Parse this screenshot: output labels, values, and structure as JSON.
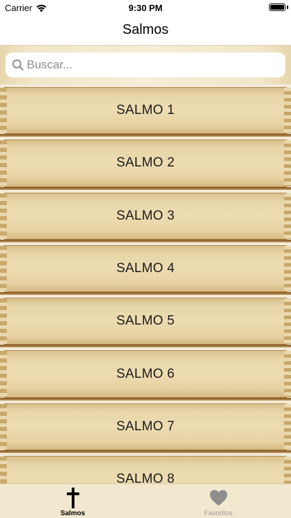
{
  "status_bar": {
    "carrier": "Carrier",
    "time": "9:30 PM"
  },
  "nav": {
    "title": "Salmos"
  },
  "search": {
    "placeholder": "Buscar..."
  },
  "psalms": [
    {
      "label": "SALMO 1"
    },
    {
      "label": "SALMO 2"
    },
    {
      "label": "SALMO 3"
    },
    {
      "label": "SALMO 4"
    },
    {
      "label": "SALMO 5"
    },
    {
      "label": "SALMO 6"
    },
    {
      "label": "SALMO 7"
    },
    {
      "label": "SALMO 8"
    }
  ],
  "tabs": [
    {
      "label": "Salmos",
      "icon": "cross-icon",
      "active": true
    },
    {
      "label": "Favoritos",
      "icon": "heart-icon",
      "active": false
    }
  ],
  "colors": {
    "tab_active": "#000000",
    "tab_inactive": "#9a9a9a",
    "plank": "#e8d6aa",
    "divider": "#7a5526"
  }
}
